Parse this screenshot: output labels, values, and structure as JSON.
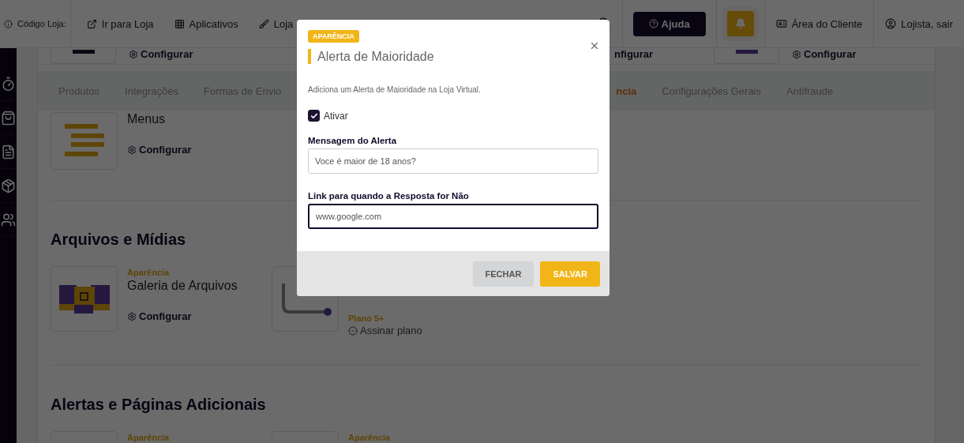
{
  "topbar": {
    "store_code_label": "Código Loja:",
    "nav": [
      {
        "kind": "external",
        "label": "Ir para Loja"
      },
      {
        "kind": "apps",
        "label": "Aplicativos"
      },
      {
        "kind": "brush",
        "label": "Loja"
      }
    ],
    "help_button": "Ajuda",
    "client_area": "Área do Cliente",
    "user": "Lojista, sair"
  },
  "sidebar": {
    "items": [
      {
        "kind": "timer"
      },
      {
        "kind": "bag"
      },
      {
        "kind": "document"
      },
      {
        "kind": "box"
      },
      {
        "kind": "users"
      }
    ]
  },
  "top_strip": [
    {
      "kind": "dark",
      "action": "Configurar"
    },
    {
      "kind": "none",
      "action": "nfigurar"
    },
    {
      "kind": "purple",
      "action": "Configurar"
    }
  ],
  "tabs": [
    {
      "label": "Produtos",
      "selected": false
    },
    {
      "label": "Integrações",
      "selected": false
    },
    {
      "label": "Formas de Envio",
      "selected": false
    },
    {
      "label": "ncia",
      "selected": true
    },
    {
      "label": "Configurações Gerais",
      "selected": false
    },
    {
      "label": "Antifraude",
      "selected": false
    }
  ],
  "sections": [
    {
      "cards": [
        {
          "kind": "menus",
          "title": "Menus",
          "action": "Configurar"
        }
      ]
    },
    {
      "title": "Arquivos e Mídias",
      "cards": [
        {
          "kind": "gallery",
          "category": "Aparência",
          "title": "Galeria de Arquivos",
          "action": "Configurar"
        },
        {
          "kind": "logo",
          "plan": "Plano 5+",
          "action": "Assinar plano"
        }
      ]
    },
    {
      "title": "Alertas e Páginas Adicionais",
      "cards": [
        {
          "kind": "blank",
          "category": "Aparência"
        },
        {
          "kind": "blank",
          "category": "Aparência"
        }
      ]
    }
  ],
  "modal": {
    "badge": "APARÊNCIA",
    "title": "Alerta de Maioridade",
    "description": "Adiciona um Alerta de Maioridade na Loja Virtual.",
    "checkbox": {
      "label": "Ativar",
      "checked": true
    },
    "fields": [
      {
        "label": "Mensagem do Alerta",
        "value": "Voce é maior de 18 anos?",
        "focused": false
      },
      {
        "label": "Link para quando a Resposta for Não",
        "value": "www.google.com",
        "focused": true
      }
    ],
    "buttons": [
      {
        "kind": "secondary",
        "label": "FECHAR"
      },
      {
        "kind": "primary",
        "label": "SALVAR"
      }
    ]
  }
}
